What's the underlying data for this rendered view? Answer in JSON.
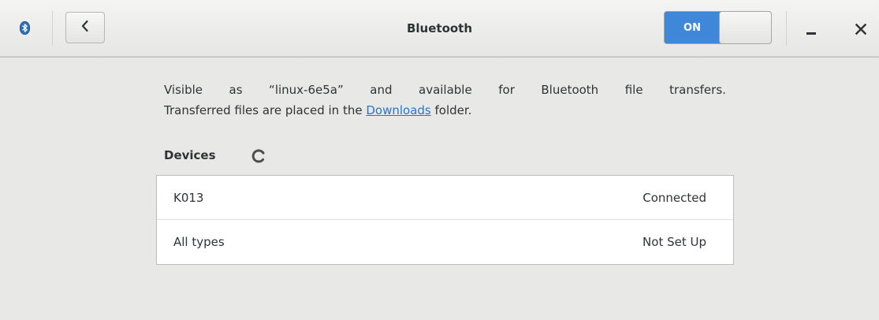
{
  "header": {
    "app_icon": "bluetooth-icon",
    "back_icon": "chevron-left-icon",
    "title": "Bluetooth",
    "switch": {
      "label": "ON",
      "state": "on",
      "accent": "#3f87d8"
    },
    "minimize_icon": "minimize-icon",
    "close_icon": "close-icon",
    "close_glyph": "×"
  },
  "content": {
    "description": {
      "line1_words": [
        "Visible",
        "as",
        "“linux-6e5a”",
        "and",
        "available",
        "for",
        "Bluetooth",
        "file",
        "transfers."
      ],
      "line2_before": "Transferred files are placed in the ",
      "line2_link": "Downloads",
      "line2_after": " folder."
    },
    "devices_heading": "Devices",
    "spinner_icon": "loading-spinner-icon",
    "devices": [
      {
        "name": "K013",
        "status": "Connected"
      },
      {
        "name": "All types",
        "status": "Not Set Up"
      }
    ]
  }
}
